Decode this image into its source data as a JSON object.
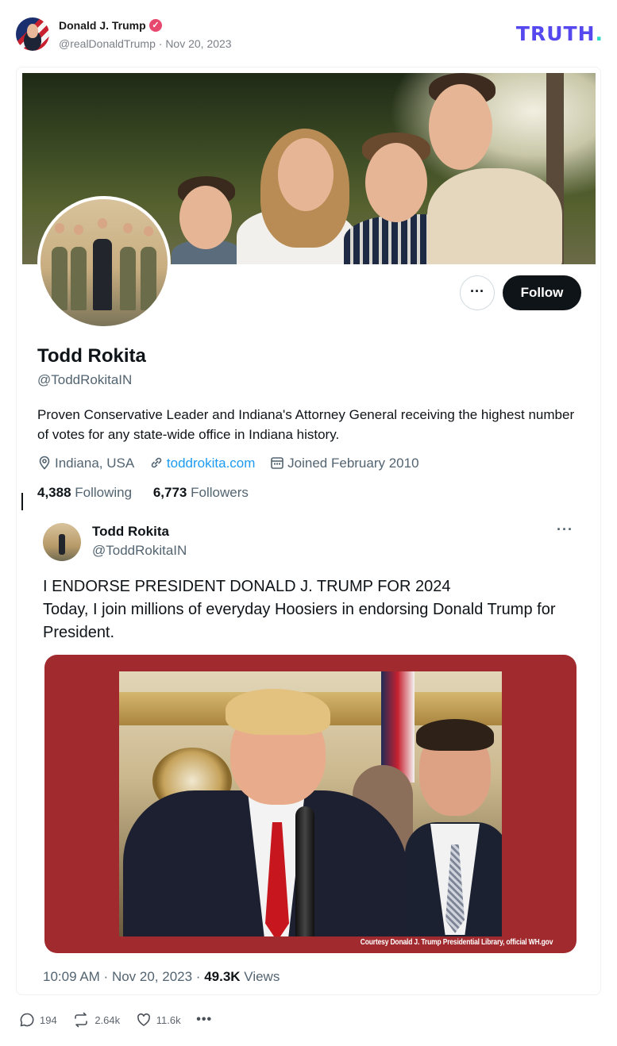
{
  "post": {
    "author_name": "Donald J. Trump",
    "author_handle": "@realDonaldTrump",
    "post_date": "Nov 20, 2023",
    "platform_logo": "TRUTH",
    "verified_badge_color": "#e8486d",
    "logo_color": "#5448ee"
  },
  "profile": {
    "more_label": "···",
    "follow_label": "Follow",
    "name": "Todd Rokita",
    "handle": "@ToddRokitaIN",
    "bio": "Proven Conservative Leader and Indiana's Attorney General receiving the highest number of votes for any state-wide office in Indiana history.",
    "location": "Indiana, USA",
    "website": "toddrokita.com",
    "joined": "Joined February 2010",
    "following_count": "4,388",
    "following_label": "Following",
    "followers_count": "6,773",
    "followers_label": "Followers"
  },
  "tweet": {
    "author": "Todd Rokita",
    "handle": "@ToddRokitaIN",
    "more_label": "···",
    "text_line1": "I ENDORSE PRESIDENT DONALD J. TRUMP FOR 2024",
    "text_line2": "Today, I join millions of everyday Hoosiers in endorsing Donald Trump for President.",
    "media_caption": "Courtesy Donald J. Trump Presidential Library, official WH.gov",
    "time": "10:09 AM",
    "date": "Nov 20, 2023",
    "views_count": "49.3K",
    "views_label": "Views",
    "media_background_color": "#a12a2e"
  },
  "actions": {
    "replies": "194",
    "retruths": "2.64k",
    "likes": "11.6k",
    "more_label": "•••",
    "icons": [
      "reply-icon",
      "retruth-icon",
      "like-icon",
      "more-icon"
    ]
  }
}
